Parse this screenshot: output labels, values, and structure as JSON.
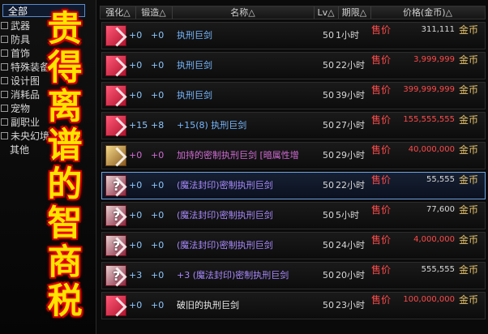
{
  "sidebar": {
    "items": [
      {
        "label": "全部",
        "selected": true
      },
      {
        "label": "武器"
      },
      {
        "label": "防具"
      },
      {
        "label": "首饰"
      },
      {
        "label": "特殊装备"
      },
      {
        "label": "设计图"
      },
      {
        "label": "消耗品"
      },
      {
        "label": "宠物"
      },
      {
        "label": "副职业"
      },
      {
        "label": "未央幻境"
      },
      {
        "label": "其他"
      }
    ]
  },
  "overlay": {
    "chars": [
      "贵",
      "得",
      "离",
      "谱",
      "的",
      "智",
      "商",
      "税"
    ],
    "color": "#ffe400",
    "outline": "#d00000"
  },
  "header": {
    "columns": [
      "强化△",
      "锻造△",
      "名称△",
      "Lv△",
      "期限△",
      "价格(金币)△"
    ]
  },
  "listing_rows": [
    {
      "qh": "+0",
      "dz": "+0",
      "name": "执刑巨剑",
      "lv": "50",
      "qx": "1小时",
      "sell": "售价",
      "price": "311,111",
      "coin": "金币",
      "name_style": "name-blue",
      "count_style": "bluecount",
      "price_style": "price-white",
      "icon": "red"
    },
    {
      "qh": "+0",
      "dz": "+0",
      "name": "执刑巨剑",
      "lv": "50",
      "qx": "22小时",
      "sell": "售价",
      "price": "3,999,999",
      "coin": "金币",
      "name_style": "name-blue",
      "count_style": "bluecount",
      "price_style": "price-red",
      "icon": "red"
    },
    {
      "qh": "+0",
      "dz": "+0",
      "name": "执刑巨剑",
      "lv": "50",
      "qx": "39小时",
      "sell": "售价",
      "price": "399,999,999",
      "coin": "金币",
      "name_style": "name-blue",
      "count_style": "bluecount",
      "price_style": "price-red",
      "icon": "red"
    },
    {
      "qh": "+15",
      "dz": "+8",
      "name": "+15(8) 执刑巨剑",
      "lv": "50",
      "qx": "27小时",
      "sell": "售价",
      "price": "155,555,555",
      "coin": "金币",
      "name_style": "name-blue",
      "count_style": "bluecount",
      "price_style": "price-red",
      "icon": "red"
    },
    {
      "qh": "+0",
      "dz": "+0",
      "name": "加持的密制执刑巨剑 [暗属性增",
      "lv": "50",
      "qx": "29小时",
      "sell": "售价",
      "price": "40,000,000",
      "coin": "金币",
      "name_style": "name-pink",
      "count_style": "pinkcount",
      "price_style": "price-red",
      "icon": "golden"
    },
    {
      "qh": "+0",
      "dz": "+0",
      "name": "(魔法封印)密制执刑巨剑",
      "lv": "50",
      "qx": "22小时",
      "sell": "售价",
      "price": "55,555",
      "coin": "金币",
      "name_style": "name-purple",
      "count_style": "bluecount",
      "price_style": "price-white",
      "icon": "sealed",
      "selected": true
    },
    {
      "qh": "+0",
      "dz": "+0",
      "name": "(魔法封印)密制执刑巨剑",
      "lv": "50",
      "qx": "5小时",
      "sell": "售价",
      "price": "77,600",
      "coin": "金币",
      "name_style": "name-purple",
      "count_style": "bluecount",
      "price_style": "price-white",
      "icon": "sealed"
    },
    {
      "qh": "+0",
      "dz": "+0",
      "name": "(魔法封印)密制执刑巨剑",
      "lv": "50",
      "qx": "24小时",
      "sell": "售价",
      "price": "4,000,000",
      "coin": "金币",
      "name_style": "name-purple",
      "count_style": "bluecount",
      "price_style": "price-red",
      "icon": "sealed"
    },
    {
      "qh": "+3",
      "dz": "+0",
      "name": "+3 (魔法封印)密制执刑巨剑",
      "lv": "50",
      "qx": "20小时",
      "sell": "售价",
      "price": "555,555",
      "coin": "金币",
      "name_style": "name-purple",
      "count_style": "bluecount",
      "price_style": "price-white",
      "icon": "sealed"
    },
    {
      "qh": "+0",
      "dz": "+0",
      "name": "破旧的执刑巨剑",
      "lv": "50",
      "qx": "23小时",
      "sell": "售价",
      "price": "100,000,000",
      "coin": "金币",
      "name_style": "name-white",
      "count_style": "bluecount",
      "price_style": "price-red",
      "icon": "red"
    }
  ]
}
